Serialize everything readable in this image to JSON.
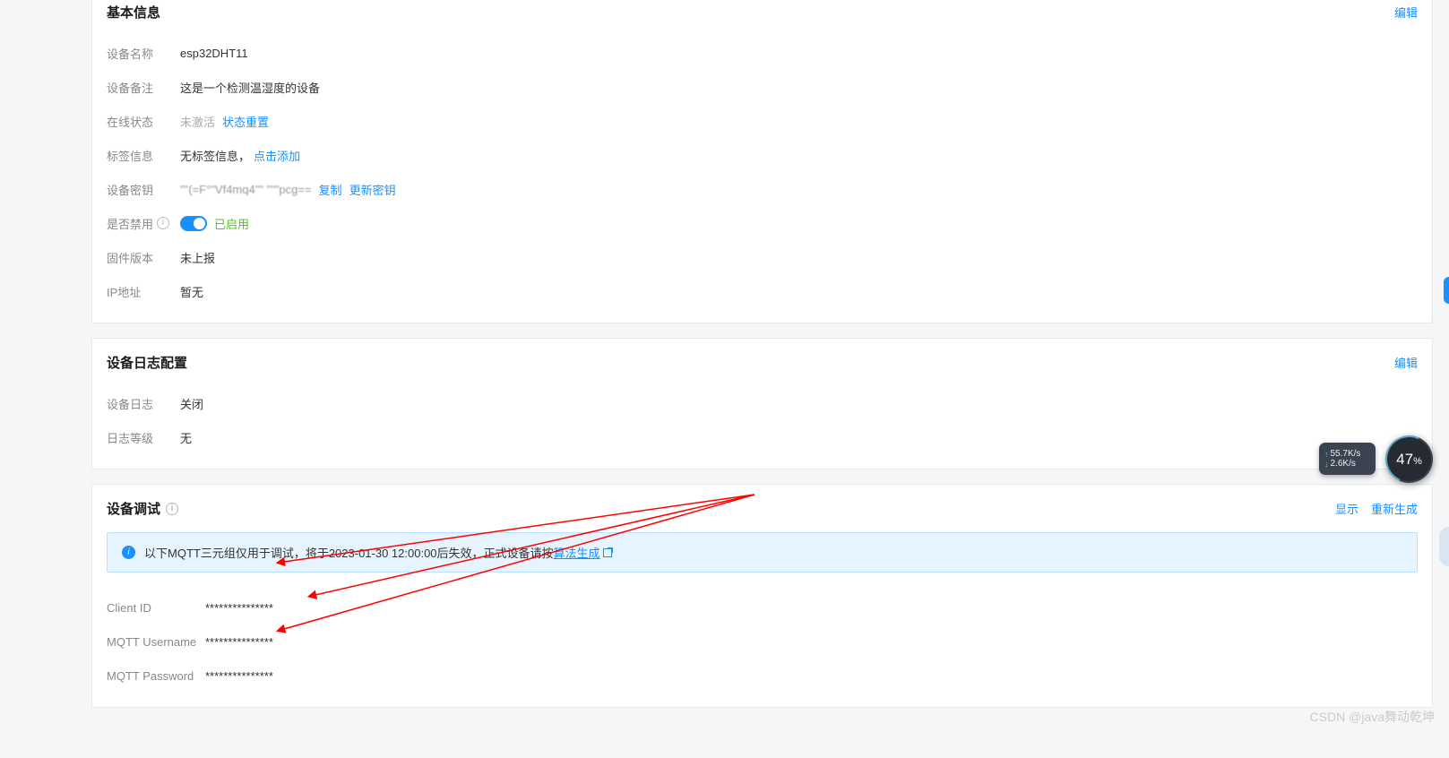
{
  "basic_info": {
    "title": "基本信息",
    "edit": "编辑",
    "rows": {
      "device_name_label": "设备名称",
      "device_name_value": "esp32DHT11",
      "device_remark_label": "设备备注",
      "device_remark_value": "这是一个检测温湿度的设备",
      "online_status_label": "在线状态",
      "online_status_value": "未激活",
      "status_reset": "状态重置",
      "tag_label": "标签信息",
      "tag_value": "无标签信息，",
      "tag_action": "点击添加",
      "device_key_label": "设备密钥",
      "device_key_value": "\"\"(=F°\"Vf4mq4\"\"    \"\"\"pcg==",
      "copy": "复制",
      "update_key": "更新密钥",
      "disabled_label": "是否禁用",
      "enabled_text": "已启用",
      "firmware_label": "固件版本",
      "firmware_value": "未上报",
      "ip_label": "IP地址",
      "ip_value": "暂无"
    }
  },
  "device_log_config": {
    "title": "设备日志配置",
    "edit": "编辑",
    "rows": {
      "device_log_label": "设备日志",
      "device_log_value": "关闭",
      "log_level_label": "日志等级",
      "log_level_value": "无"
    }
  },
  "device_debug": {
    "title": "设备调试",
    "show": "显示",
    "regenerate": "重新生成",
    "banner_prefix": "以下MQTT三元组仅用于调试，将于2023-01-30 12:00:00后失效，正式设备请按",
    "banner_link": "算法生成",
    "rows": {
      "client_id_label": "Client ID",
      "client_id_value": "***************",
      "mqtt_user_label": "MQTT Username",
      "mqtt_user_value": "***************",
      "mqtt_pass_label": "MQTT Password",
      "mqtt_pass_value": "***************"
    }
  },
  "widgets": {
    "up_speed": "55.7K/s",
    "down_speed": "2.6K/s",
    "percent": "47",
    "percent_sign": "%"
  },
  "watermark": "CSDN @java舞动乾坤"
}
